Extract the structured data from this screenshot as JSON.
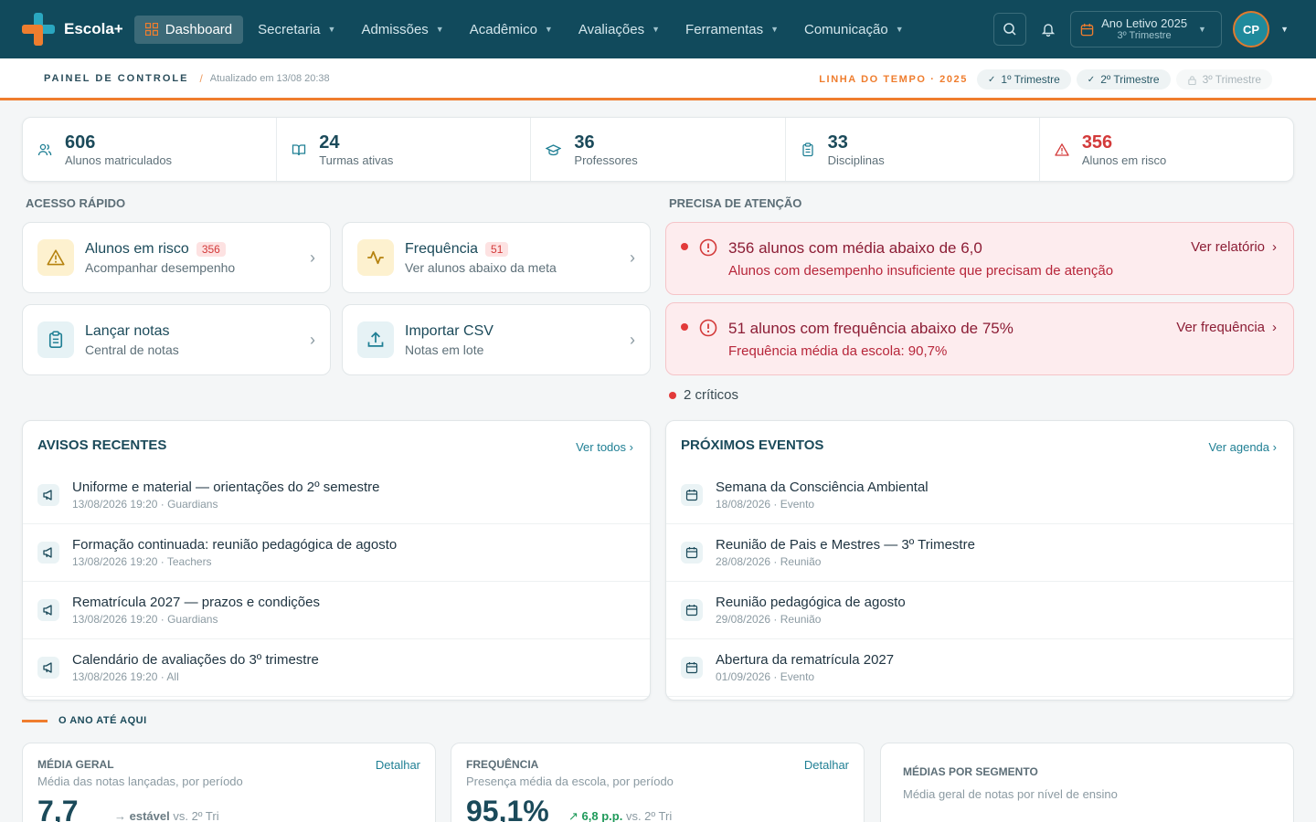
{
  "brand": {
    "name": "Escola+"
  },
  "nav": [
    {
      "label": "Dashboard",
      "icon": "grid-icon"
    },
    {
      "label": "Secretaria"
    },
    {
      "label": "Admissões"
    },
    {
      "label": "Acadêmico"
    },
    {
      "label": "Avaliações"
    },
    {
      "label": "Ferramentas"
    },
    {
      "label": "Comunicação"
    }
  ],
  "year_selector": {
    "main": "Ano Letivo 2025",
    "sub": "3º Trimestre"
  },
  "avatar": {
    "initials": "CP"
  },
  "subbar": {
    "title": "PAINEL DE CONTROLE",
    "separator": "/",
    "updated": "Atualizado em 13/08 20:38",
    "timeline_label": "LINHA DO TEMPO · 2025",
    "trimesters": [
      {
        "label": "1º Trimestre",
        "state": "done"
      },
      {
        "label": "2º Trimestre",
        "state": "done"
      },
      {
        "label": "3º Trimestre",
        "state": "locked"
      }
    ]
  },
  "stats": [
    {
      "value": "606",
      "label": "Alunos matriculados",
      "icon": "users-icon"
    },
    {
      "value": "24",
      "label": "Turmas ativas",
      "icon": "book-icon"
    },
    {
      "value": "36",
      "label": "Professores",
      "icon": "graduation-cap-icon"
    },
    {
      "value": "33",
      "label": "Disciplinas",
      "icon": "clipboard-icon"
    },
    {
      "value": "356",
      "label": "Alunos em risco",
      "icon": "warning-icon"
    }
  ],
  "quick_access": {
    "title": "ACESSO RÁPIDO",
    "cards": [
      {
        "title": "Alunos em risco",
        "badge": "356",
        "sub": "Acompanhar desempenho",
        "icon": "warning-icon"
      },
      {
        "title": "Frequência",
        "badge": "51",
        "sub": "Ver alunos abaixo da meta",
        "icon": "activity-icon"
      },
      {
        "title": "Lançar notas",
        "badge": "",
        "sub": "Central de notas",
        "icon": "clipboard-icon"
      },
      {
        "title": "Importar CSV",
        "badge": "",
        "sub": "Notas em lote",
        "icon": "upload-icon"
      }
    ]
  },
  "attention": {
    "title": "PRECISA DE ATENÇÃO",
    "alerts": [
      {
        "title": "356 alunos com média abaixo de 6,0",
        "sub": "Alunos com desempenho insuficiente que precisam de atenção",
        "link": "Ver relatório"
      },
      {
        "title": "51 alunos com frequência abaixo de 75%",
        "sub": "Frequência média da escola: 90,7%",
        "link": "Ver frequência"
      }
    ],
    "critical": "2 críticos"
  },
  "notices": {
    "title": "AVISOS RECENTES",
    "link": "Ver todos",
    "items": [
      {
        "title": "Uniforme e material — orientações do 2º semestre",
        "meta": "13/08/2026 19:20 · Guardians"
      },
      {
        "title": "Formação continuada: reunião pedagógica de agosto",
        "meta": "13/08/2026 19:20 · Teachers"
      },
      {
        "title": "Rematrícula 2027 — prazos e condições",
        "meta": "13/08/2026 19:20 · Guardians"
      },
      {
        "title": "Calendário de avaliações do 3º trimestre",
        "meta": "13/08/2026 19:20 · All"
      }
    ]
  },
  "events": {
    "title": "PRÓXIMOS EVENTOS",
    "link": "Ver agenda",
    "items": [
      {
        "title": "Semana da Consciência Ambiental",
        "meta": "18/08/2026 · Evento"
      },
      {
        "title": "Reunião de Pais e Mestres — 3º Trimestre",
        "meta": "28/08/2026 · Reunião"
      },
      {
        "title": "Reunião pedagógica de agosto",
        "meta": "29/08/2026 · Reunião"
      },
      {
        "title": "Abertura da rematrícula 2027",
        "meta": "01/09/2026 · Evento"
      }
    ]
  },
  "year_section": {
    "title": "O ANO ATÉ AQUI"
  },
  "metrics": [
    {
      "title": "MÉDIA GERAL",
      "sub": "Média das notas lançadas, por período",
      "link": "Detalhar",
      "value": "7,7",
      "trend_value": "estável",
      "trend_ref": "vs. 2º Tri"
    },
    {
      "title": "FREQUÊNCIA",
      "sub": "Presença média da escola, por período",
      "link": "Detalhar",
      "value": "95,1%",
      "trend_value": "6,8 p.p.",
      "trend_ref": "vs. 2º Tri"
    },
    {
      "title": "MÉDIAS POR SEGMENTO",
      "sub": "Média geral de notas por nível de ensino"
    }
  ],
  "colors": {
    "topbar": "#114a5c",
    "accent": "#ef7d2e",
    "danger": "#d33a3a",
    "teal": "#1f7f94"
  }
}
